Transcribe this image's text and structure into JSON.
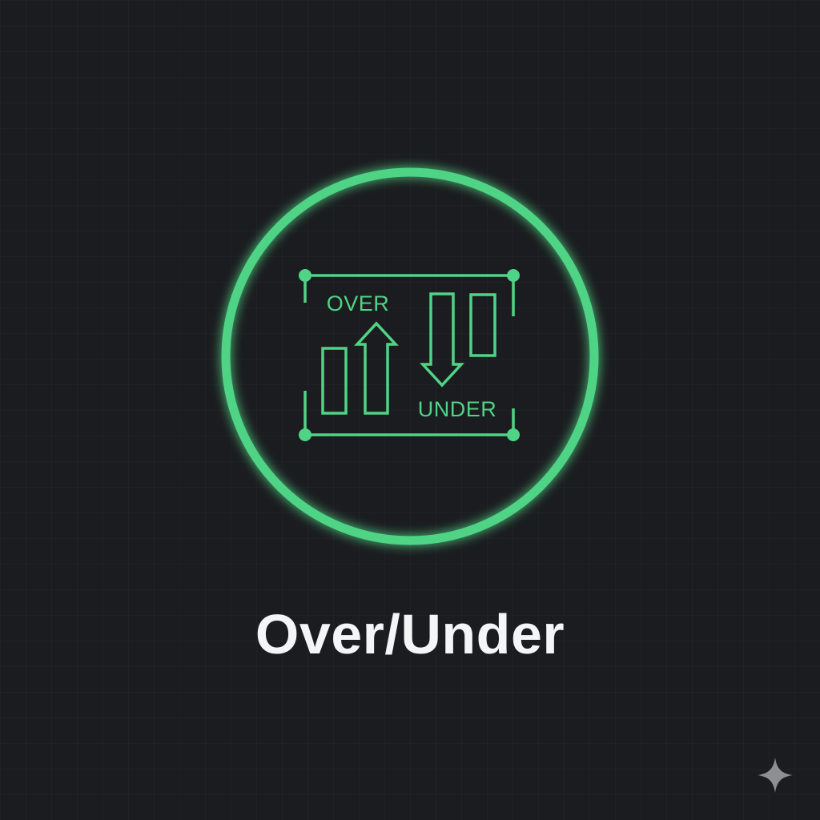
{
  "emblem": {
    "over_label": "OVER",
    "under_label": "UNDER",
    "accent_color": "#4fd486",
    "icon": "over-under-bars-icon"
  },
  "title": "Over/Under",
  "corner_icon": "sparkle-icon",
  "colors": {
    "background": "#1b1c1f",
    "title_text": "#f4f5f6",
    "accent": "#4fd486",
    "sparkle": "#8e8f92"
  }
}
